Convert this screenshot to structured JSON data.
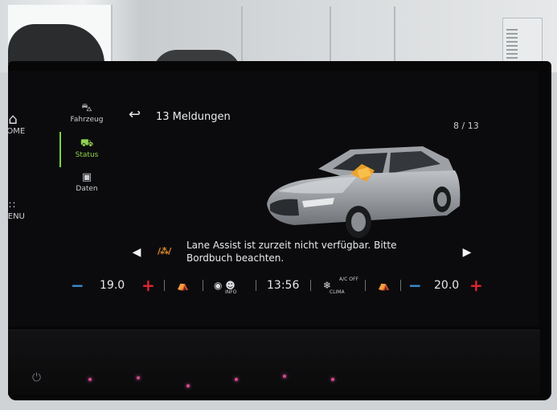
{
  "nav": {
    "home_label": "HOME",
    "menu_label": "MENU",
    "tabs": [
      {
        "label": "Fahrzeug",
        "icon": "car-icon"
      },
      {
        "label": "Status",
        "icon": "car-status-icon",
        "active": true
      },
      {
        "label": "Daten",
        "icon": "data-icon"
      }
    ]
  },
  "header": {
    "title": "13 Meldungen",
    "pager": "8 / 13"
  },
  "message": {
    "text": "Lane Assist ist zurzeit nicht verfügbar. Bitte Bordbuch beachten.",
    "icon": "lane-assist-warning-icon"
  },
  "climate": {
    "left_temp": "19.0",
    "right_temp": "20.0",
    "time": "13:56",
    "info_label": "INFO",
    "clima_label": "CLIMA",
    "ac_label": "A/C OFF"
  },
  "colors": {
    "accent_active": "#7ed43f",
    "warning": "#e28a2e",
    "minus": "#3d8fd8",
    "plus": "#e0262e"
  }
}
